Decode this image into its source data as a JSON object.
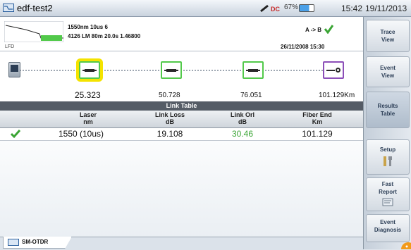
{
  "window": {
    "title": "edf-test2",
    "battery": "67%",
    "time": "15:42",
    "date": "19/11/2013"
  },
  "header": {
    "trace_label": "LFD",
    "line1": "1550nm  10us   6",
    "line2": "4126 LM  80m  20.0s  1.46800",
    "direction": "A -> B",
    "acq_date": "26/11/2008  15:30"
  },
  "linkmap": {
    "distances": [
      "25.323",
      "50.728",
      "76.051",
      "101.129Km"
    ]
  },
  "table": {
    "title": "Link Table",
    "columns": [
      {
        "name": "Laser",
        "unit": "nm"
      },
      {
        "name": "Link Loss",
        "unit": "dB"
      },
      {
        "name": "Link Orl",
        "unit": "dB"
      },
      {
        "name": "Fiber End",
        "unit": "Km"
      }
    ],
    "row": {
      "laser": "1550 (10us)",
      "loss": "19.108",
      "orl": "30.46",
      "end": "101.129"
    }
  },
  "tab": {
    "label": "SM-OTDR"
  },
  "sidebar": {
    "trace_view": [
      "Trace",
      "View"
    ],
    "event_view": [
      "Event",
      "View"
    ],
    "results_table": [
      "Results",
      "Table"
    ],
    "setup": "Setup",
    "fast_report": [
      "Fast",
      "Report"
    ],
    "event_diagnosis": [
      "Event",
      "Diagnosis"
    ]
  },
  "colors": {
    "accent_green": "#52c94a",
    "selected": "#f4e300",
    "end_event": "#8c4fb8",
    "orl_value": "#3aa534"
  }
}
